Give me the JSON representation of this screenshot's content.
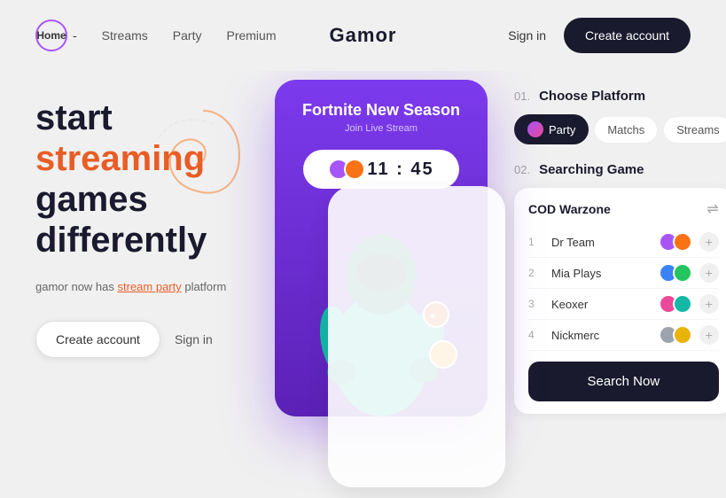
{
  "nav": {
    "home_label": "Home",
    "home_dash": "-",
    "streams_label": "Streams",
    "party_label": "Party",
    "premium_label": "Premium",
    "brand_name": "Gamor",
    "sign_in_label": "Sign in",
    "create_account_label": "Create account"
  },
  "hero": {
    "line1": "start",
    "line2": "streaming",
    "line3": "games",
    "line4": "differently",
    "tagline_start": "gamor now has ",
    "tagline_link": "stream party",
    "tagline_end": " platform",
    "create_account_btn": "Create account",
    "sign_in_btn": "Sign in"
  },
  "game_card": {
    "title": "Fortnite New Season",
    "subtitle": "Join Live Stream",
    "timer": "11 : 45"
  },
  "right_panel": {
    "step1_number": "01.",
    "step1_title_choose": "Choose",
    "step1_title_rest": " Platform",
    "tab_party": "Party",
    "tab_matches": "Matchs",
    "tab_streams": "Streams",
    "step2_number": "02.",
    "step2_title_searching": "Searching",
    "step2_title_rest": " Game",
    "game_name": "COD Warzone",
    "players": [
      {
        "rank": "1",
        "name": "Dr Team"
      },
      {
        "rank": "2",
        "name": "Mia Plays"
      },
      {
        "rank": "3",
        "name": "Keoxer"
      },
      {
        "rank": "4",
        "name": "Nickmerc"
      }
    ],
    "search_btn": "Search Now"
  }
}
